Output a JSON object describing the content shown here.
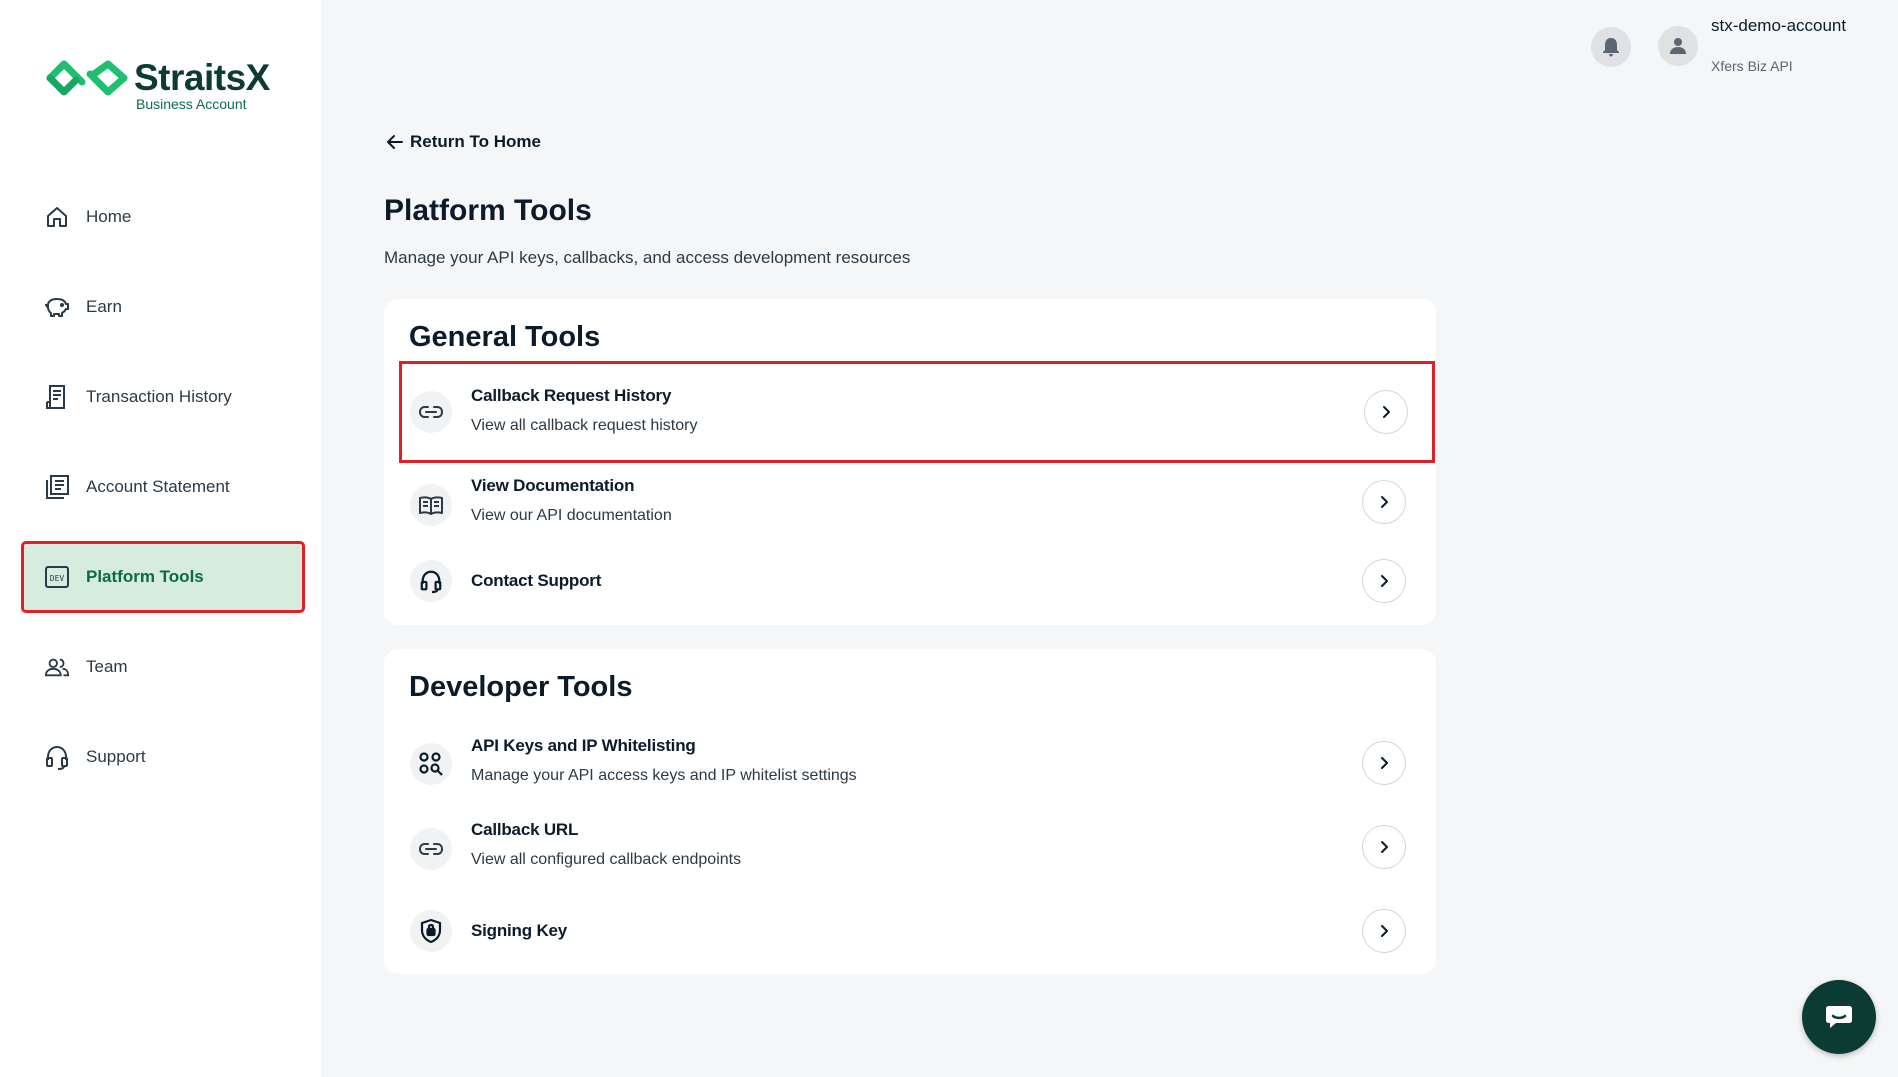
{
  "brand": {
    "name": "StraitsX",
    "subtitle": "Business Account"
  },
  "sidebar": {
    "items": [
      {
        "label": "Home",
        "icon": "home-icon"
      },
      {
        "label": "Earn",
        "icon": "piggy-bank-icon"
      },
      {
        "label": "Transaction History",
        "icon": "receipt-icon"
      },
      {
        "label": "Account Statement",
        "icon": "statement-icon"
      },
      {
        "label": "Platform Tools",
        "icon": "dev-icon",
        "active": true
      },
      {
        "label": "Team",
        "icon": "team-icon"
      },
      {
        "label": "Support",
        "icon": "headset-icon"
      }
    ]
  },
  "header": {
    "account_name": "stx-demo-account",
    "account_sub": "Xfers Biz API"
  },
  "main": {
    "back_label": "Return To Home",
    "title": "Platform Tools",
    "description": "Manage your API keys, callbacks, and access development resources",
    "general": {
      "title": "General Tools",
      "items": [
        {
          "title": "Callback Request History",
          "subtitle": "View all callback request history",
          "icon": "link-icon"
        },
        {
          "title": "View Documentation",
          "subtitle": "View our API documentation",
          "icon": "book-icon"
        },
        {
          "title": "Contact Support",
          "subtitle": "",
          "icon": "headset-icon"
        }
      ]
    },
    "developer": {
      "title": "Developer Tools",
      "items": [
        {
          "title": "API Keys and IP Whitelisting",
          "subtitle": "Manage your API access keys and IP whitelist settings",
          "icon": "key-search-icon"
        },
        {
          "title": "Callback URL",
          "subtitle": "View all configured callback endpoints",
          "icon": "link-icon"
        },
        {
          "title": "Signing Key",
          "subtitle": "",
          "icon": "shield-lock-icon"
        }
      ]
    }
  },
  "colors": {
    "brand_green": "#0b6b43",
    "active_bg": "#d5ecdf",
    "highlight_red": "#e01f26",
    "fab": "#0c3b34"
  }
}
